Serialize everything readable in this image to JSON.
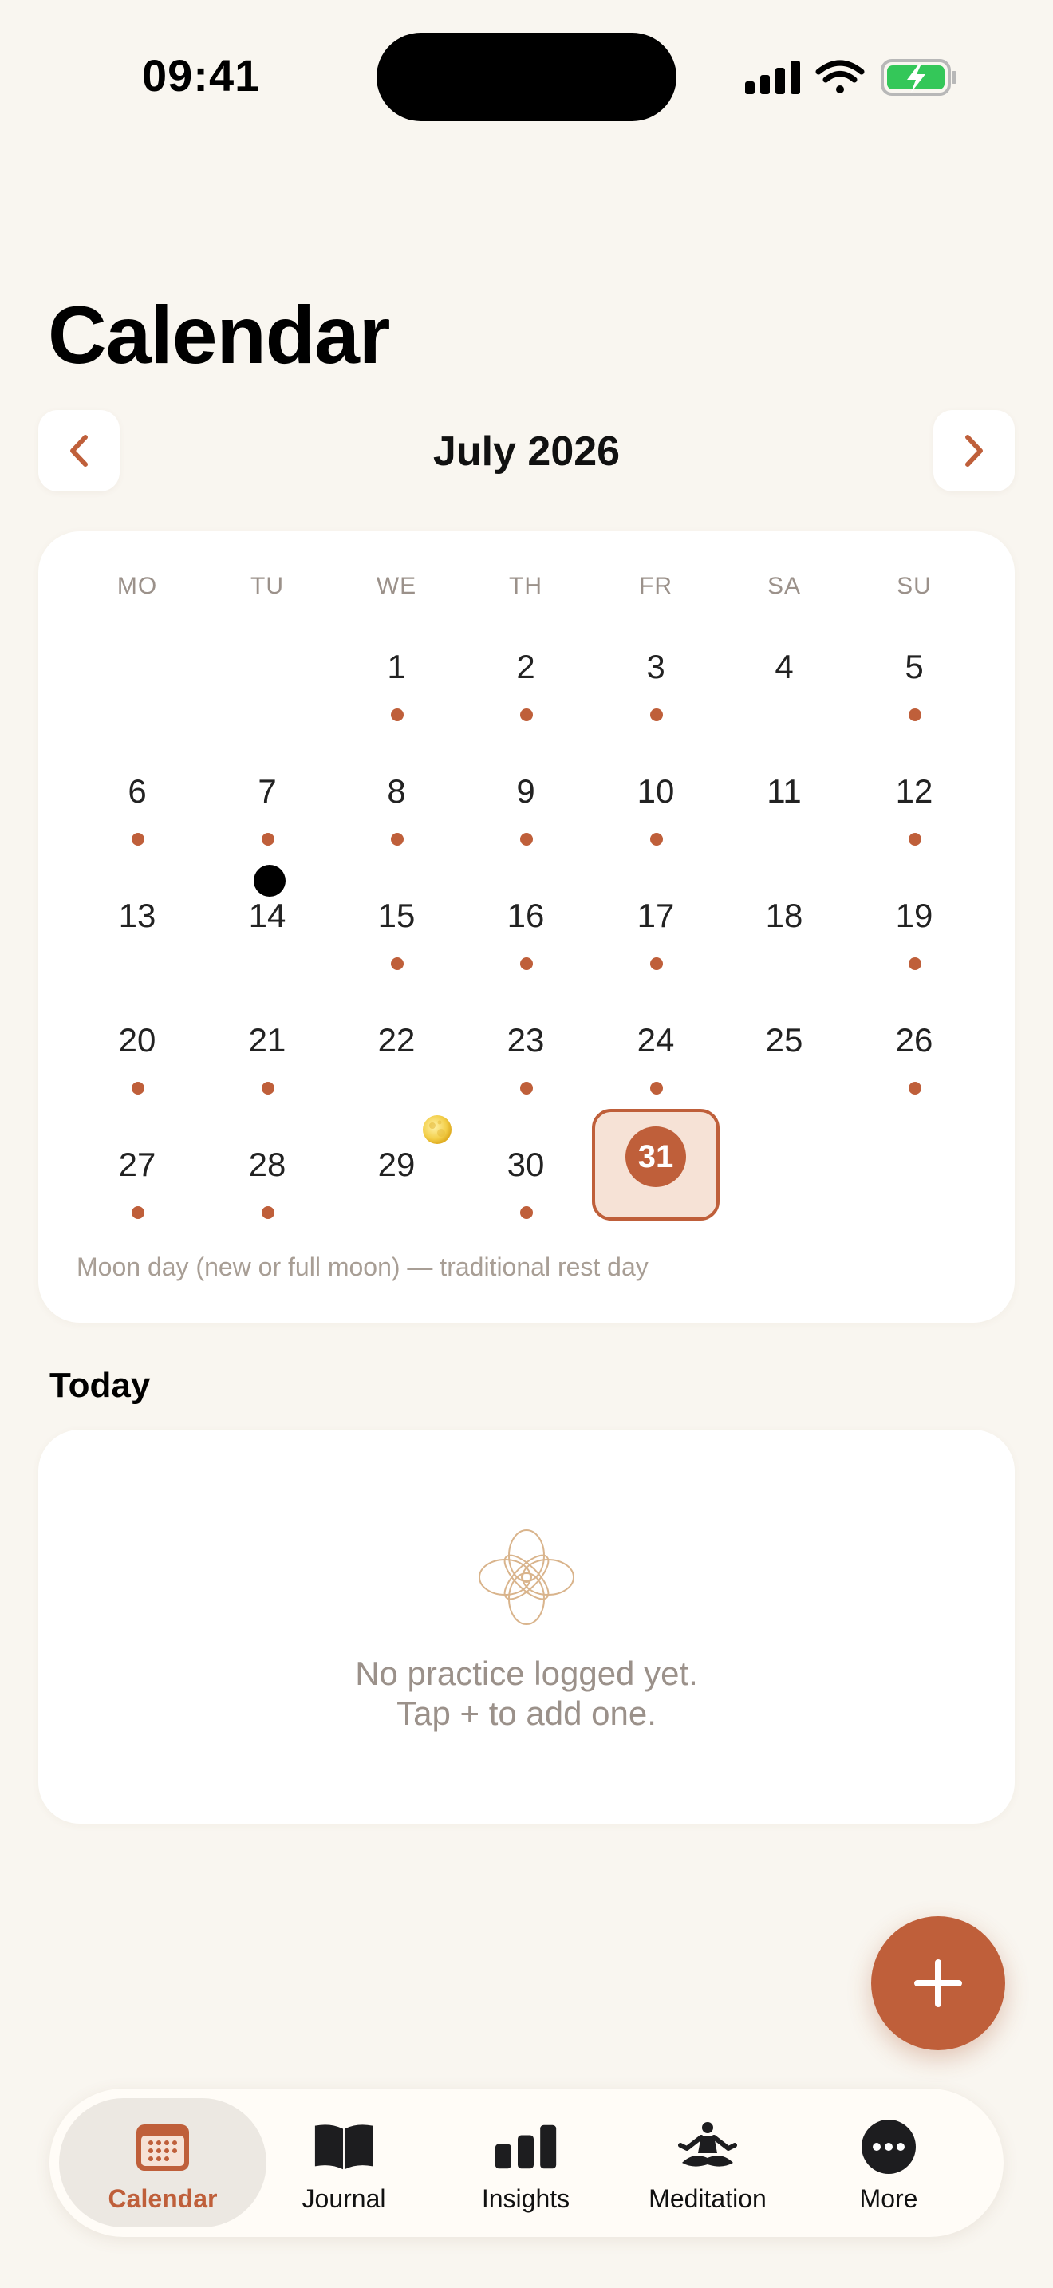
{
  "status_bar": {
    "time": "09:41"
  },
  "page": {
    "title": "Calendar"
  },
  "month_nav": {
    "label": "July 2026",
    "prev_icon": "chevron-left-icon",
    "next_icon": "chevron-right-icon"
  },
  "calendar": {
    "weekdays": [
      "MO",
      "TU",
      "WE",
      "TH",
      "FR",
      "SA",
      "SU"
    ],
    "today": "31",
    "weeks": [
      [
        {
          "day": "",
          "dot": false
        },
        {
          "day": "",
          "dot": false
        },
        {
          "day": "1",
          "dot": true
        },
        {
          "day": "2",
          "dot": true
        },
        {
          "day": "3",
          "dot": true
        },
        {
          "day": "4",
          "dot": false
        },
        {
          "day": "5",
          "dot": true
        }
      ],
      [
        {
          "day": "6",
          "dot": true
        },
        {
          "day": "7",
          "dot": true
        },
        {
          "day": "8",
          "dot": true
        },
        {
          "day": "9",
          "dot": true
        },
        {
          "day": "10",
          "dot": true
        },
        {
          "day": "11",
          "dot": false
        },
        {
          "day": "12",
          "dot": true
        }
      ],
      [
        {
          "day": "13",
          "dot": false
        },
        {
          "day": "14",
          "dot": false,
          "moon": "new"
        },
        {
          "day": "15",
          "dot": true
        },
        {
          "day": "16",
          "dot": true
        },
        {
          "day": "17",
          "dot": true
        },
        {
          "day": "18",
          "dot": false
        },
        {
          "day": "19",
          "dot": true
        }
      ],
      [
        {
          "day": "20",
          "dot": true
        },
        {
          "day": "21",
          "dot": true
        },
        {
          "day": "22",
          "dot": false
        },
        {
          "day": "23",
          "dot": true
        },
        {
          "day": "24",
          "dot": true
        },
        {
          "day": "25",
          "dot": false
        },
        {
          "day": "26",
          "dot": true
        }
      ],
      [
        {
          "day": "27",
          "dot": true
        },
        {
          "day": "28",
          "dot": true
        },
        {
          "day": "29",
          "dot": false,
          "moon": "full"
        },
        {
          "day": "30",
          "dot": true
        },
        {
          "day": "31",
          "dot": false,
          "today": true
        },
        {
          "day": "",
          "dot": false
        },
        {
          "day": "",
          "dot": false
        }
      ]
    ],
    "legend": "Moon day (new or full moon) — traditional rest day",
    "colors": {
      "accent": "#bf5f3a",
      "today_bg": "#f6e2d6"
    }
  },
  "today_section": {
    "title": "Today",
    "empty_line1": "No practice logged yet.",
    "empty_line2": "Tap + to add one.",
    "empty_icon": "lotus-icon"
  },
  "fab": {
    "icon": "plus-icon"
  },
  "tab_bar": {
    "tabs": [
      {
        "label": "Calendar",
        "icon": "calendar-icon",
        "active": true
      },
      {
        "label": "Journal",
        "icon": "book-icon",
        "active": false
      },
      {
        "label": "Insights",
        "icon": "bar-chart-icon",
        "active": false
      },
      {
        "label": "Meditation",
        "icon": "meditation-icon",
        "active": false
      },
      {
        "label": "More",
        "icon": "more-icon",
        "active": false
      }
    ]
  }
}
